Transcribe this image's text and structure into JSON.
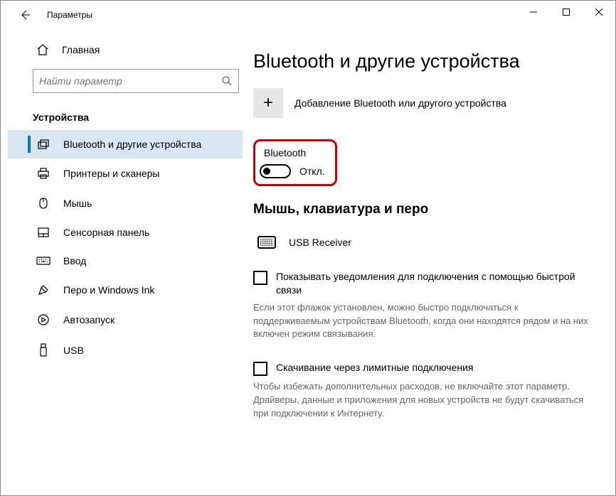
{
  "titlebar": {
    "title": "Параметры"
  },
  "sidebar": {
    "home_label": "Главная",
    "search_placeholder": "Найти параметр",
    "section_label": "Устройства",
    "items": [
      {
        "label": "Bluetooth и другие устройства"
      },
      {
        "label": "Принтеры и сканеры"
      },
      {
        "label": "Мышь"
      },
      {
        "label": "Сенсорная панель"
      },
      {
        "label": "Ввод"
      },
      {
        "label": "Перо и Windows Ink"
      },
      {
        "label": "Автозапуск"
      },
      {
        "label": "USB"
      }
    ]
  },
  "main": {
    "page_title": "Bluetooth и другие устройства",
    "add_device_label": "Добавление Bluetooth или другого устройства",
    "bluetooth": {
      "label": "Bluetooth",
      "state": "Откл."
    },
    "devices_heading": "Мышь, клавиатура и перо",
    "device1": "USB Receiver",
    "option1": {
      "label": "Показывать уведомления для подключения с помощью быстрой связи",
      "desc": "Если этот флажок установлен, можно быстро подключаться к поддерживаемым устройствам Bluetooth, когда они находятся рядом и на них включен режим связывания."
    },
    "option2": {
      "label": "Скачивание через лимитные подключения",
      "desc": "Чтобы избежать дополнительных расходов, не включайте этот параметр. Драйверы, данные и приложения для новых устройств не будут скачиваться при подключении к Интернету."
    }
  }
}
